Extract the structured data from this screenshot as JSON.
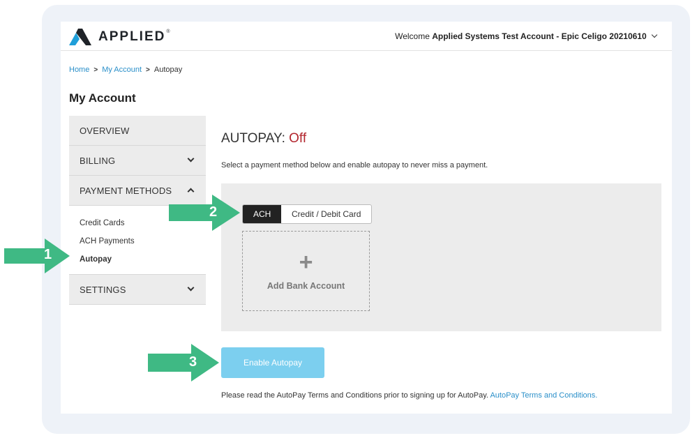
{
  "header": {
    "logo_text": "APPLIED",
    "logo_mark": "®",
    "welcome_prefix": "Welcome",
    "account_name": "Applied Systems Test Account - Epic Celigo 20210610"
  },
  "breadcrumb": {
    "home": "Home",
    "my_account": "My Account",
    "current": "Autopay",
    "separator": ">"
  },
  "page_title": "My Account",
  "sidebar": {
    "overview": "OVERVIEW",
    "billing": "BILLING",
    "payment_methods": "PAYMENT METHODS",
    "sub_items": [
      "Credit Cards",
      "ACH Payments",
      "Autopay"
    ],
    "settings": "SETTINGS"
  },
  "main": {
    "title_prefix": "AUTOPAY:",
    "status": "Off",
    "description": "Select a payment method below and enable autopay to never miss a payment.",
    "tabs": [
      "ACH",
      "Credit / Debit Card"
    ],
    "add_symbol": "+",
    "add_label": "Add Bank Account",
    "enable_button": "Enable Autopay",
    "terms_text": "Please read the AutoPay Terms and Conditions prior to signing up for AutoPay.",
    "terms_link": "AutoPay Terms and Conditions."
  },
  "callouts": [
    "1",
    "2",
    "3"
  ],
  "colors": {
    "accent_blue": "#2a8fc9",
    "button_blue": "#7ccfef",
    "status_red": "#b3262e",
    "callout_green": "#3fb984"
  }
}
